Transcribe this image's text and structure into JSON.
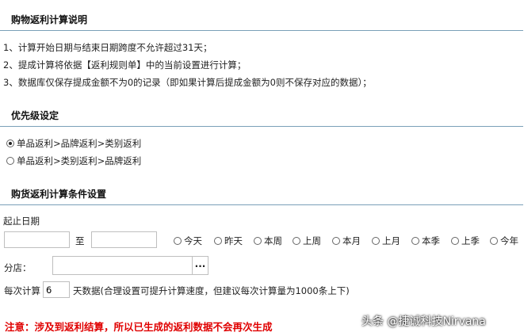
{
  "sections": {
    "rebate_explain": {
      "title": "购物返利计算说明",
      "items": [
        "1、计算开始日期与结束日期跨度不允许超过31天；",
        "2、提成计算将依据【返利规则单】中的当前设置进行计算；",
        "3、数据库仅保存提成金额不为0的记录（即如果计算后提成金额为0则不保存对应的数据）；"
      ]
    },
    "priority": {
      "title": "优先级设定",
      "options": [
        {
          "label": "单品返利>品牌返利>类别返利",
          "checked": true
        },
        {
          "label": "单品返利>类别返利>品牌返利",
          "checked": false
        }
      ]
    },
    "conditions": {
      "title": "购货返利计算条件设置",
      "date_label": "起止日期",
      "to_label": "至",
      "start_date": "",
      "end_date": "",
      "quick_ranges": [
        "今天",
        "昨天",
        "本周",
        "上周",
        "本月",
        "上月",
        "本季",
        "上季",
        "今年"
      ],
      "store_label": "分店：",
      "store_value": "",
      "browse_label": "...",
      "batch_prefix": "每次计算",
      "batch_value": "6",
      "batch_suffix": "天数据(合理设置可提升计算速度，但建议每次计算量为1000条上下)"
    }
  },
  "warning": "注意：涉及到返利结算，所以已生成的返利数据不会再次生成",
  "watermark": "头条 @捷诚科技Nirvana",
  "colors": {
    "divider": "#7aa0b8",
    "warning": "#e00000"
  }
}
